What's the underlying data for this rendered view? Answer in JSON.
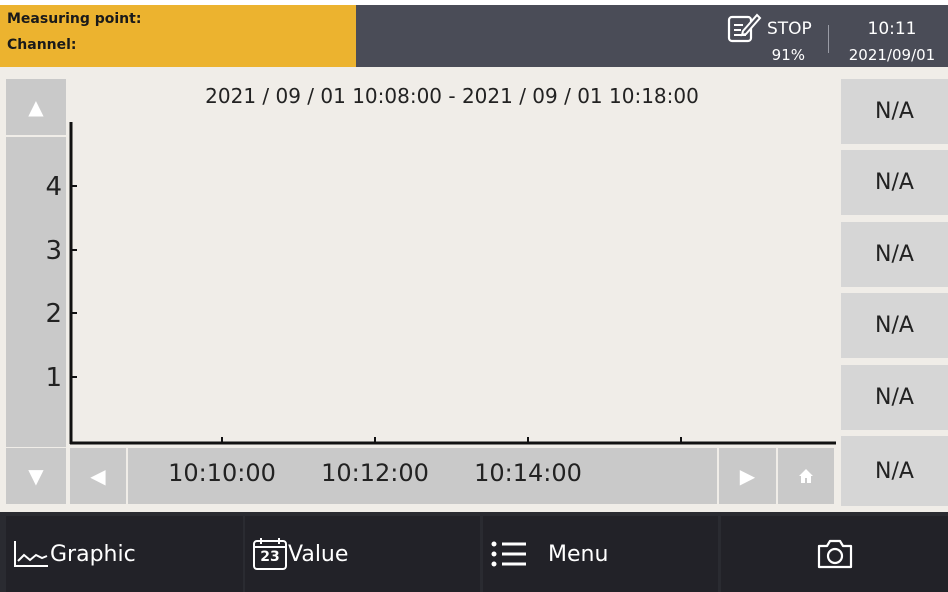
{
  "header": {
    "measuring_point_label": "Measuring point:",
    "channel_label": "Channel:",
    "status": "STOP",
    "storage_percent": "91%",
    "time": "10:11",
    "date": "2021/09/01",
    "colors": {
      "left_bg": "#ecb32f",
      "right_bg": "#4a4c57"
    }
  },
  "graph": {
    "time_range": "2021 / 09 / 01 10:08:00 - 2021 / 09 / 01 10:18:00",
    "y_ticks": [
      "4",
      "3",
      "2",
      "1"
    ],
    "x_ticks": [
      "10:10:00",
      "10:12:00",
      "10:14:00"
    ],
    "buttons": {
      "scroll_up": "▲",
      "scroll_down": "▼",
      "prev": "◀",
      "next": "▶",
      "home": "home-icon"
    }
  },
  "values": [
    "N/A",
    "N/A",
    "N/A",
    "N/A",
    "N/A",
    "N/A"
  ],
  "toolbar": {
    "graphic_label": "Graphic",
    "value_label": "Value",
    "value_icon_text": "23",
    "menu_label": "Menu",
    "camera": "camera-icon"
  }
}
